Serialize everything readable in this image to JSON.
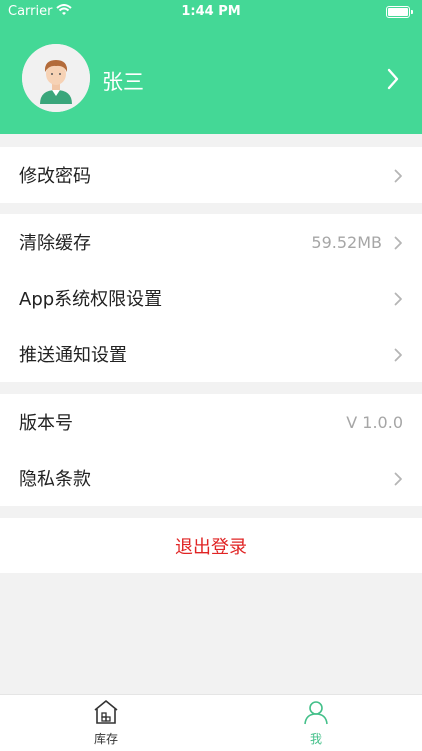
{
  "status_bar": {
    "carrier": "Carrier",
    "time": "1:44 PM",
    "wifi_icon": "wifi-icon",
    "battery_icon": "battery-icon"
  },
  "profile": {
    "name": "张三",
    "avatar_icon": "user-avatar-icon",
    "arrow_icon": "chevron-right-icon"
  },
  "menu": {
    "change_password": "修改密码",
    "clear_cache": "清除缓存",
    "cache_size": "59.52MB",
    "app_permissions": "App系统权限设置",
    "push_settings": "推送通知设置",
    "version_label": "版本号",
    "version_value": "V 1.0.0",
    "privacy": "隐私条款"
  },
  "logout": {
    "label": "退出登录"
  },
  "tabbar": {
    "items": [
      {
        "label": "库存",
        "icon": "warehouse-icon",
        "active": false
      },
      {
        "label": "我",
        "icon": "person-icon",
        "active": true
      }
    ]
  },
  "colors": {
    "header": "#44d896",
    "accent": "#44c08a",
    "logout": "#e02424",
    "background": "#f2f2f2"
  }
}
